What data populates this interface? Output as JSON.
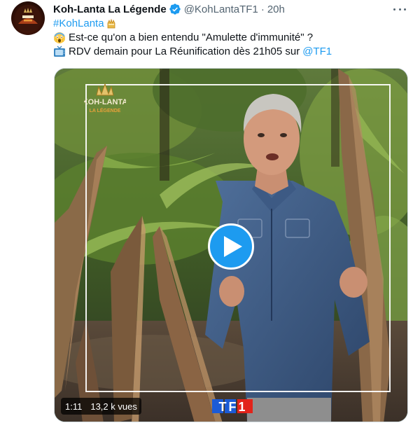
{
  "account": {
    "display_name": "Koh-Lanta La Légende",
    "handle": "@KohLantaTF1",
    "separator": "·",
    "time": "20h",
    "verified": true,
    "avatar_icon": "koh-lanta-logo-icon"
  },
  "tweet": {
    "hashtag": "#KohLanta",
    "line2_emoji": "screaming-face-emoji",
    "line2_text": "Est-ce qu'on a bien entendu \"Amulette d'immunité\" ?",
    "line3_emoji": "television-emoji",
    "line3_text": "RDV demain pour La Réunification dès 21h05 sur ",
    "mention": "@TF1"
  },
  "media": {
    "duration": "1:11",
    "views": "13,2 k vues",
    "overlay_logo_text": "KOH-LANTA",
    "overlay_logo_subtext": "LA LÉGENDE",
    "channel_logo_text": "TF1"
  },
  "colors": {
    "link": "#1d9bf0",
    "verified": "#1d9bf0",
    "play_button": "#1d9bf0",
    "secondary_text": "#536471"
  }
}
